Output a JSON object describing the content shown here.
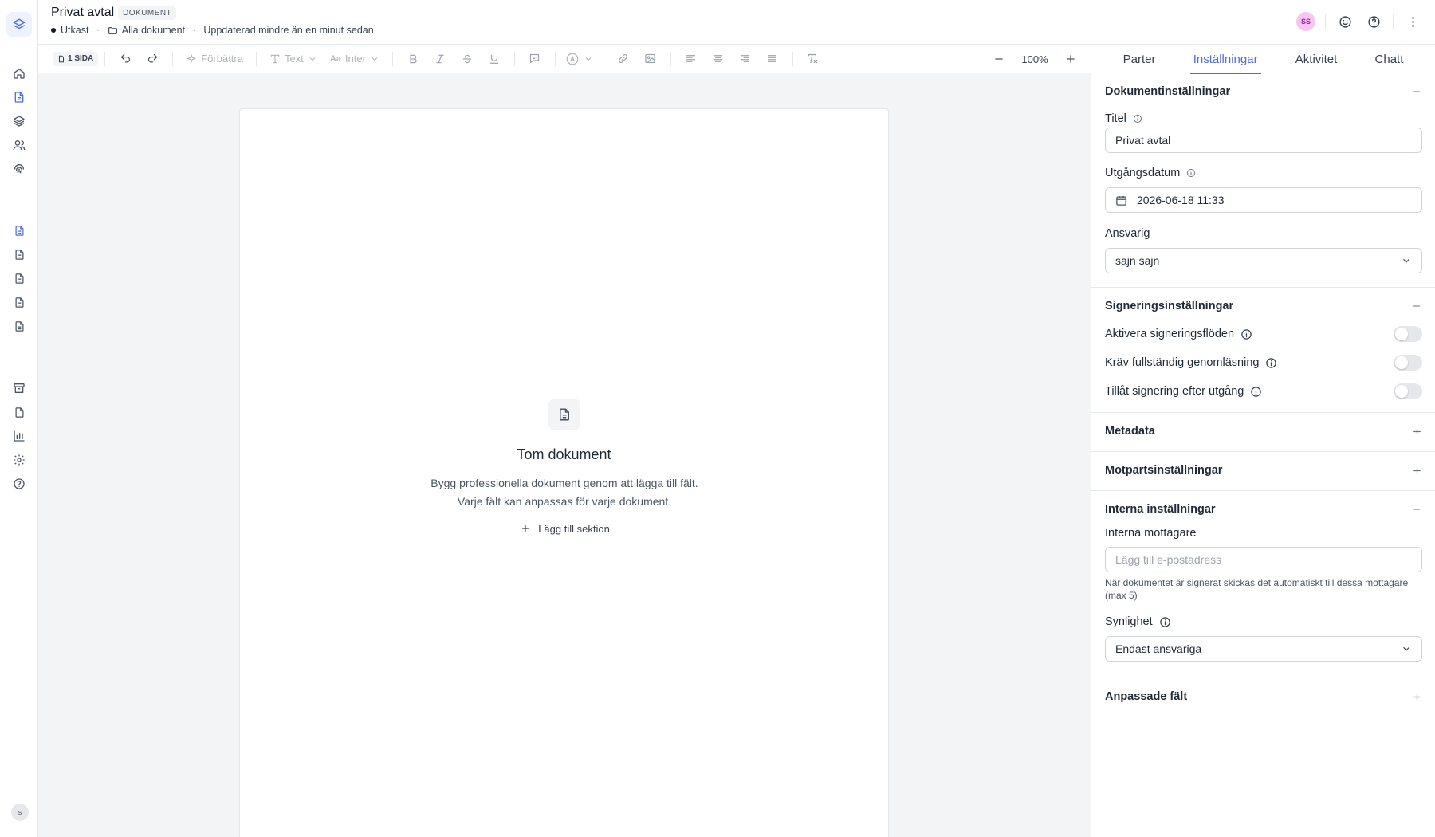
{
  "header": {
    "title": "Privat avtal",
    "badge": "DOKUMENT",
    "status": "Utkast",
    "folder": "Alla dokument",
    "updated": "Uppdaterad mindre än en minut sedan",
    "user_initials": "SS"
  },
  "toolbar": {
    "pages_label": "1 SIDA",
    "improve_label": "Förbättra",
    "text_style_label": "Text",
    "font_label": "Inter",
    "zoom": "100%"
  },
  "sidebar": {
    "user_initial": "s",
    "icons": [
      "layers-logo-icon",
      "home-icon",
      "document-icon",
      "layers-icon",
      "users-icon",
      "fingerprint-icon",
      "document-icon",
      "document-icon",
      "document-icon",
      "document-icon",
      "document-icon",
      "archive-icon",
      "file-icon",
      "chart-icon",
      "gear-icon",
      "help-icon"
    ]
  },
  "document": {
    "empty_title": "Tom dokument",
    "empty_description": "Bygg professionella dokument genom att lägga till fält. Varje fält kan anpassas för varje dokument.",
    "add_section_label": "Lägg till sektion"
  },
  "panel": {
    "tabs": [
      "Parter",
      "Inställningar",
      "Aktivitet",
      "Chatt"
    ],
    "active_tab": "Inställningar",
    "doc_settings": {
      "title": "Dokumentinställningar",
      "title_label": "Titel",
      "title_value": "Privat avtal",
      "expiry_label": "Utgångsdatum",
      "expiry_value": "2026-06-18 11:33",
      "owner_label": "Ansvarig",
      "owner_value": "sajn sajn"
    },
    "signing_settings": {
      "title": "Signeringsinställningar",
      "toggles": [
        {
          "label": "Aktivera signeringsflöden",
          "on": false
        },
        {
          "label": "Kräv fullständig genomläsning",
          "on": false
        },
        {
          "label": "Tillåt signering efter utgång",
          "on": false
        }
      ]
    },
    "metadata_title": "Metadata",
    "counterparty_title": "Motpartsinställningar",
    "internal_settings": {
      "title": "Interna inställningar",
      "recipients_label": "Interna mottagare",
      "recipients_placeholder": "Lägg till e-postadress",
      "help_text": "När dokumentet är signerat skickas det automatiskt till dessa mottagare (max 5)",
      "visibility_label": "Synlighet",
      "visibility_value": "Endast ansvariga"
    },
    "custom_fields_title": "Anpassade fält"
  }
}
